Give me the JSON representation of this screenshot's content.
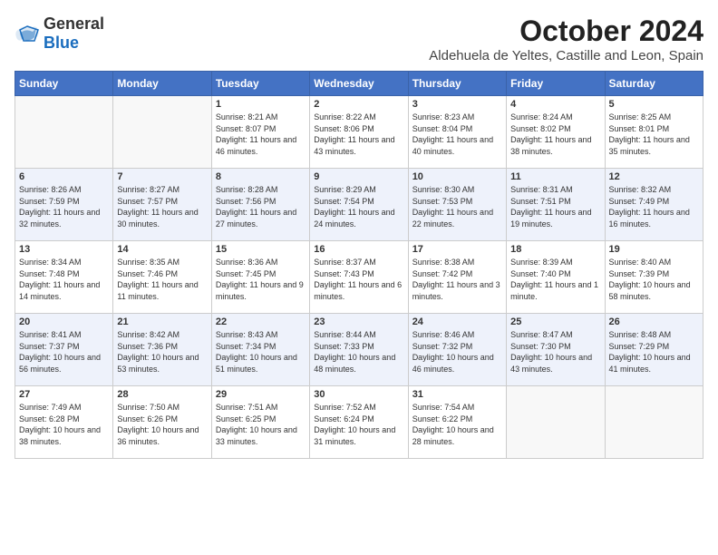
{
  "logo": {
    "text_general": "General",
    "text_blue": "Blue"
  },
  "title": "October 2024",
  "subtitle": "Aldehuela de Yeltes, Castille and Leon, Spain",
  "days_of_week": [
    "Sunday",
    "Monday",
    "Tuesday",
    "Wednesday",
    "Thursday",
    "Friday",
    "Saturday"
  ],
  "weeks": [
    [
      {
        "day": "",
        "sunrise": "",
        "sunset": "",
        "daylight": "",
        "empty": true
      },
      {
        "day": "",
        "sunrise": "",
        "sunset": "",
        "daylight": "",
        "empty": true
      },
      {
        "day": "1",
        "sunrise": "Sunrise: 8:21 AM",
        "sunset": "Sunset: 8:07 PM",
        "daylight": "Daylight: 11 hours and 46 minutes."
      },
      {
        "day": "2",
        "sunrise": "Sunrise: 8:22 AM",
        "sunset": "Sunset: 8:06 PM",
        "daylight": "Daylight: 11 hours and 43 minutes."
      },
      {
        "day": "3",
        "sunrise": "Sunrise: 8:23 AM",
        "sunset": "Sunset: 8:04 PM",
        "daylight": "Daylight: 11 hours and 40 minutes."
      },
      {
        "day": "4",
        "sunrise": "Sunrise: 8:24 AM",
        "sunset": "Sunset: 8:02 PM",
        "daylight": "Daylight: 11 hours and 38 minutes."
      },
      {
        "day": "5",
        "sunrise": "Sunrise: 8:25 AM",
        "sunset": "Sunset: 8:01 PM",
        "daylight": "Daylight: 11 hours and 35 minutes."
      }
    ],
    [
      {
        "day": "6",
        "sunrise": "Sunrise: 8:26 AM",
        "sunset": "Sunset: 7:59 PM",
        "daylight": "Daylight: 11 hours and 32 minutes."
      },
      {
        "day": "7",
        "sunrise": "Sunrise: 8:27 AM",
        "sunset": "Sunset: 7:57 PM",
        "daylight": "Daylight: 11 hours and 30 minutes."
      },
      {
        "day": "8",
        "sunrise": "Sunrise: 8:28 AM",
        "sunset": "Sunset: 7:56 PM",
        "daylight": "Daylight: 11 hours and 27 minutes."
      },
      {
        "day": "9",
        "sunrise": "Sunrise: 8:29 AM",
        "sunset": "Sunset: 7:54 PM",
        "daylight": "Daylight: 11 hours and 24 minutes."
      },
      {
        "day": "10",
        "sunrise": "Sunrise: 8:30 AM",
        "sunset": "Sunset: 7:53 PM",
        "daylight": "Daylight: 11 hours and 22 minutes."
      },
      {
        "day": "11",
        "sunrise": "Sunrise: 8:31 AM",
        "sunset": "Sunset: 7:51 PM",
        "daylight": "Daylight: 11 hours and 19 minutes."
      },
      {
        "day": "12",
        "sunrise": "Sunrise: 8:32 AM",
        "sunset": "Sunset: 7:49 PM",
        "daylight": "Daylight: 11 hours and 16 minutes."
      }
    ],
    [
      {
        "day": "13",
        "sunrise": "Sunrise: 8:34 AM",
        "sunset": "Sunset: 7:48 PM",
        "daylight": "Daylight: 11 hours and 14 minutes."
      },
      {
        "day": "14",
        "sunrise": "Sunrise: 8:35 AM",
        "sunset": "Sunset: 7:46 PM",
        "daylight": "Daylight: 11 hours and 11 minutes."
      },
      {
        "day": "15",
        "sunrise": "Sunrise: 8:36 AM",
        "sunset": "Sunset: 7:45 PM",
        "daylight": "Daylight: 11 hours and 9 minutes."
      },
      {
        "day": "16",
        "sunrise": "Sunrise: 8:37 AM",
        "sunset": "Sunset: 7:43 PM",
        "daylight": "Daylight: 11 hours and 6 minutes."
      },
      {
        "day": "17",
        "sunrise": "Sunrise: 8:38 AM",
        "sunset": "Sunset: 7:42 PM",
        "daylight": "Daylight: 11 hours and 3 minutes."
      },
      {
        "day": "18",
        "sunrise": "Sunrise: 8:39 AM",
        "sunset": "Sunset: 7:40 PM",
        "daylight": "Daylight: 11 hours and 1 minute."
      },
      {
        "day": "19",
        "sunrise": "Sunrise: 8:40 AM",
        "sunset": "Sunset: 7:39 PM",
        "daylight": "Daylight: 10 hours and 58 minutes."
      }
    ],
    [
      {
        "day": "20",
        "sunrise": "Sunrise: 8:41 AM",
        "sunset": "Sunset: 7:37 PM",
        "daylight": "Daylight: 10 hours and 56 minutes."
      },
      {
        "day": "21",
        "sunrise": "Sunrise: 8:42 AM",
        "sunset": "Sunset: 7:36 PM",
        "daylight": "Daylight: 10 hours and 53 minutes."
      },
      {
        "day": "22",
        "sunrise": "Sunrise: 8:43 AM",
        "sunset": "Sunset: 7:34 PM",
        "daylight": "Daylight: 10 hours and 51 minutes."
      },
      {
        "day": "23",
        "sunrise": "Sunrise: 8:44 AM",
        "sunset": "Sunset: 7:33 PM",
        "daylight": "Daylight: 10 hours and 48 minutes."
      },
      {
        "day": "24",
        "sunrise": "Sunrise: 8:46 AM",
        "sunset": "Sunset: 7:32 PM",
        "daylight": "Daylight: 10 hours and 46 minutes."
      },
      {
        "day": "25",
        "sunrise": "Sunrise: 8:47 AM",
        "sunset": "Sunset: 7:30 PM",
        "daylight": "Daylight: 10 hours and 43 minutes."
      },
      {
        "day": "26",
        "sunrise": "Sunrise: 8:48 AM",
        "sunset": "Sunset: 7:29 PM",
        "daylight": "Daylight: 10 hours and 41 minutes."
      }
    ],
    [
      {
        "day": "27",
        "sunrise": "Sunrise: 7:49 AM",
        "sunset": "Sunset: 6:28 PM",
        "daylight": "Daylight: 10 hours and 38 minutes."
      },
      {
        "day": "28",
        "sunrise": "Sunrise: 7:50 AM",
        "sunset": "Sunset: 6:26 PM",
        "daylight": "Daylight: 10 hours and 36 minutes."
      },
      {
        "day": "29",
        "sunrise": "Sunrise: 7:51 AM",
        "sunset": "Sunset: 6:25 PM",
        "daylight": "Daylight: 10 hours and 33 minutes."
      },
      {
        "day": "30",
        "sunrise": "Sunrise: 7:52 AM",
        "sunset": "Sunset: 6:24 PM",
        "daylight": "Daylight: 10 hours and 31 minutes."
      },
      {
        "day": "31",
        "sunrise": "Sunrise: 7:54 AM",
        "sunset": "Sunset: 6:22 PM",
        "daylight": "Daylight: 10 hours and 28 minutes."
      },
      {
        "day": "",
        "sunrise": "",
        "sunset": "",
        "daylight": "",
        "empty": true
      },
      {
        "day": "",
        "sunrise": "",
        "sunset": "",
        "daylight": "",
        "empty": true
      }
    ]
  ]
}
